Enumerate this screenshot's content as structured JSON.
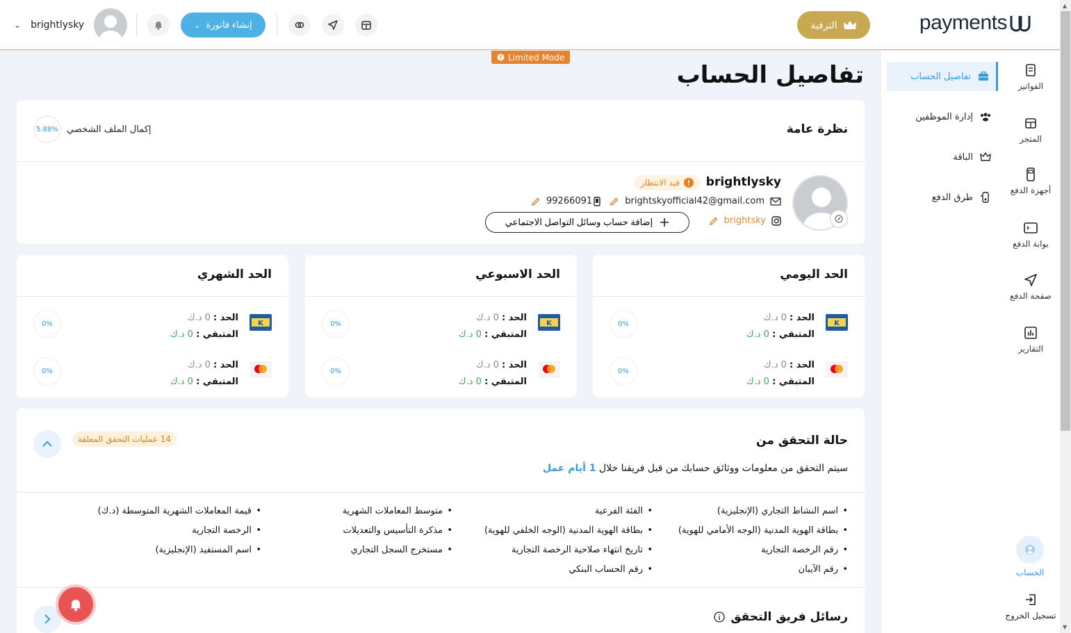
{
  "header": {
    "logo_text": "payments",
    "upgrade_label": "الترقية",
    "invoice_label": "إنشاء فاتورة",
    "username": "brightlysky"
  },
  "limited_mode": "Limited Mode",
  "nav": {
    "rail": [
      {
        "label": "الفواتير",
        "icon": "invoice-icon"
      },
      {
        "label": "المتجر",
        "icon": "store-icon"
      },
      {
        "label": "أجهزة الدفع",
        "icon": "pos-device-icon"
      },
      {
        "label": "بوابة الدفع",
        "icon": "gateway-icon"
      },
      {
        "label": "صفحة الدفع",
        "icon": "send-icon"
      },
      {
        "label": "التقارير",
        "icon": "report-icon"
      }
    ],
    "sub": [
      {
        "label": "تفاصيل الحساب",
        "icon": "briefcase-icon",
        "active": true
      },
      {
        "label": "إدارة الموظفين",
        "icon": "users-icon"
      },
      {
        "label": "الباقة",
        "icon": "crown-icon"
      },
      {
        "label": "طرق الدفع",
        "icon": "payment-methods-icon"
      }
    ],
    "account_label": "الحساب",
    "logout_label": "تسجيل الخروج"
  },
  "page": {
    "title": "تفاصيل الحساب"
  },
  "overview": {
    "title": "نظرة عامة",
    "progress_label": "إكمال الملف الشخصي",
    "progress_value": "5.88%",
    "name": "brightlysky",
    "status": "قيد الانتظار",
    "email": "brightskyofficial42@gmail.com",
    "phone": "99266091",
    "instagram": "brightsky",
    "add_social_label": "إضافة حساب وسائل التواصل الاجتماعي"
  },
  "limits": [
    {
      "title": "الحد اليومي",
      "rows": [
        {
          "method": "knet",
          "limit_label": "الحد :",
          "limit_value": "0 د.ك",
          "remaining_label": "المتبقي :",
          "remaining_value": "0 د.ك",
          "pct": "0%"
        },
        {
          "method": "mastercard",
          "limit_label": "الحد :",
          "limit_value": "0 د.ك",
          "remaining_label": "المتبقي :",
          "remaining_value": "0 د.ك",
          "pct": "0%"
        }
      ]
    },
    {
      "title": "الحد الاسبوعي",
      "rows": [
        {
          "method": "knet",
          "limit_label": "الحد :",
          "limit_value": "0 د.ك",
          "remaining_label": "المتبقي :",
          "remaining_value": "0 د.ك",
          "pct": "0%"
        },
        {
          "method": "mastercard",
          "limit_label": "الحد :",
          "limit_value": "0 د.ك",
          "remaining_label": "المتبقي :",
          "remaining_value": "0 د.ك",
          "pct": "0%"
        }
      ]
    },
    {
      "title": "الحد الشهري",
      "rows": [
        {
          "method": "knet",
          "limit_label": "الحد :",
          "limit_value": "0 د.ك",
          "remaining_label": "المتبقي :",
          "remaining_value": "0 د.ك",
          "pct": "0%"
        },
        {
          "method": "mastercard",
          "limit_label": "الحد :",
          "limit_value": "0 د.ك",
          "remaining_label": "المتبقي :",
          "remaining_value": "0 د.ك",
          "pct": "0%"
        }
      ]
    }
  ],
  "verification": {
    "title": "حالة التحقق من",
    "badge": "14 عمليات التحقق المعلقة",
    "desc_prefix": "سيتم التحقق من معلومات ووثائق حسابك من قبل فريقنا خلال",
    "desc_highlight": "1 أيام عمل",
    "columns": [
      [
        "اسم النشاط التجاري (الإنجليزية)",
        "بطاقة الهوية المدنية (الوجه الأمامي للهوية)",
        "رقم الرخصة التجارية",
        "رقم الآيبان"
      ],
      [
        "الفئة الفرعية",
        "بطاقة الهوية المدنية (الوجه الخلفي للهوية)",
        "تاريخ انتهاء صلاحية الرخصة التجارية",
        "رقم الحساب البنكي"
      ],
      [
        "متوسط المعاملات الشهرية",
        "مذكرة التأسيس والتعديلات",
        "مستخرج السجل التجاري"
      ],
      [
        "قيمة المعاملات الشهرية المتوسطة (د.ك)",
        "الرخصة التجارية",
        "اسم المستفيد (الإنجليزية)"
      ]
    ],
    "messages_title": "رسائل فريق التحقق"
  }
}
